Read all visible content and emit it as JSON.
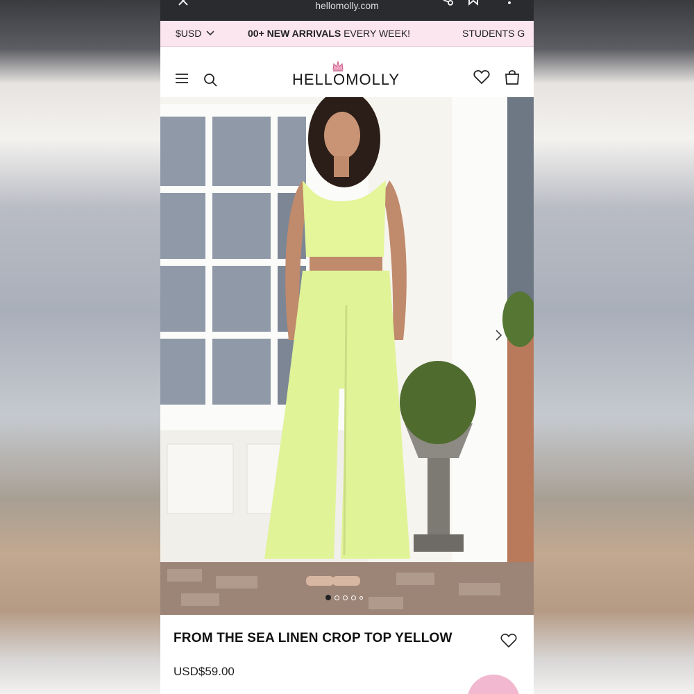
{
  "browser": {
    "url": "hellomolly.com",
    "icons": [
      "close-icon",
      "share-icon",
      "bookmark-icon",
      "more-icon"
    ]
  },
  "announcement": {
    "currency": "$USD",
    "message_bold": "00+ NEW ARRIVALS",
    "message_rest": " EVERY WEEK!",
    "message_secondary": "STUDENTS G",
    "background": "#fbe5ee"
  },
  "header": {
    "logo_text": "HELLOMOLLY",
    "icons": [
      "menu-icon",
      "search-icon",
      "crown-icon",
      "heart-icon",
      "bag-icon"
    ]
  },
  "product": {
    "title": "FROM THE SEA LINEN CROP TOP YELLOW",
    "price": "USD$59.00",
    "image_count": 5,
    "active_image": 1,
    "garment_color": "#e4f59a"
  }
}
